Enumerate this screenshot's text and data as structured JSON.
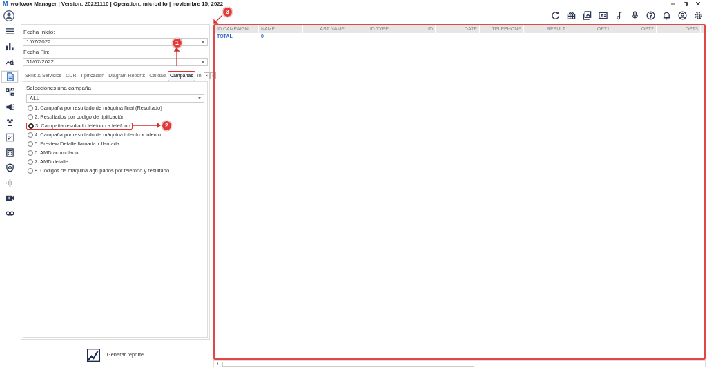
{
  "window": {
    "logo": "M",
    "title": "wolkvox Manager  | Version: 20221110 |  Operation: microdllo | noviembre 15, 2022"
  },
  "sidebar": {
    "items": [
      {
        "selected": false
      },
      {
        "selected": false
      },
      {
        "selected": false
      },
      {
        "selected": true
      },
      {
        "selected": false
      },
      {
        "selected": false
      },
      {
        "selected": false
      },
      {
        "selected": false
      },
      {
        "selected": false
      },
      {
        "selected": false
      },
      {
        "selected": false
      },
      {
        "selected": false
      },
      {
        "selected": false
      }
    ]
  },
  "filters": [
    {
      "label": "Fecha Inicio:",
      "value": "1/07/2022"
    },
    {
      "label": "Fecha Fin:",
      "value": "31/07/2022"
    }
  ],
  "tabs": [
    {
      "label": "Skills & Servicios",
      "selected": false,
      "highlighted": false
    },
    {
      "label": "CDR",
      "selected": false,
      "highlighted": false
    },
    {
      "label": "Tipificación",
      "selected": false,
      "highlighted": false
    },
    {
      "label": "Diagram Reports",
      "selected": false,
      "highlighted": false
    },
    {
      "label": "Calidad",
      "selected": false,
      "highlighted": false
    },
    {
      "label": "Campañas",
      "selected": true,
      "highlighted": true
    },
    {
      "label": "In",
      "selected": false,
      "highlighted": false
    }
  ],
  "campaign": {
    "label": "Selecciones una campaña",
    "value": "ALL"
  },
  "reports": [
    {
      "label": "1. Campaña por resultado de máquina final (Resultado)",
      "selected": false,
      "highlighted": false
    },
    {
      "label": "2. Resultados por codigo de tipificación",
      "selected": false,
      "highlighted": false
    },
    {
      "label": "3. Campaña resultado teléfono a teléfono",
      "selected": true,
      "highlighted": true
    },
    {
      "label": "4. Campaña por resultado de máquina intento x intento",
      "selected": false,
      "highlighted": false
    },
    {
      "label": "5. Preview Detalle llamada x llamada",
      "selected": false,
      "highlighted": false
    },
    {
      "label": "6. AMD acumulado",
      "selected": false,
      "highlighted": false
    },
    {
      "label": "7. AMD detalle",
      "selected": false,
      "highlighted": false
    },
    {
      "label": "8. Codigos de maquina agrupados por teléfono y resultado",
      "selected": false,
      "highlighted": false
    }
  ],
  "generate_button": "Generar reporte",
  "table": {
    "highlighted": true,
    "columns": [
      "ID CAMPAIGN",
      "NAME",
      "LAST NAME",
      "ID TYPE",
      "ID",
      "DATE",
      "TELEPHONE",
      "RESULT",
      "OPT1",
      "OPT2",
      "OPT3"
    ],
    "rows": [
      [
        "TOTAL",
        "0"
      ]
    ]
  },
  "annotations": [
    {
      "label": "1"
    },
    {
      "label": "2"
    },
    {
      "label": "3"
    }
  ]
}
